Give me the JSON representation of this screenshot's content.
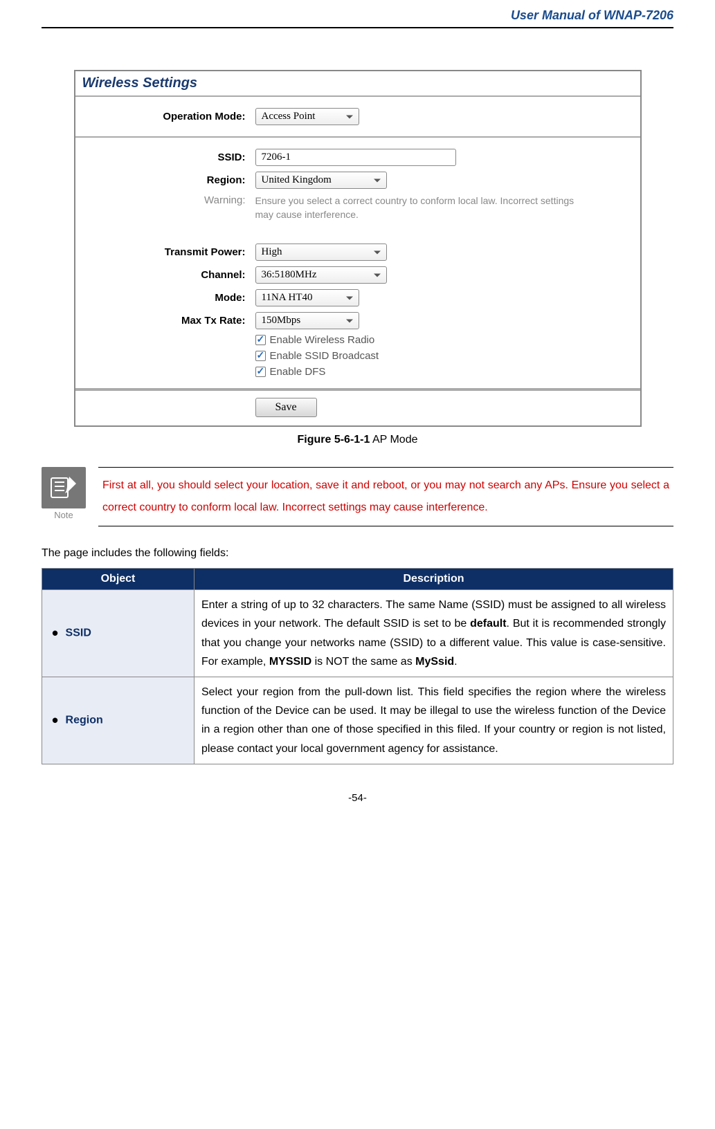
{
  "header": {
    "title": "User Manual of WNAP-7206"
  },
  "panel": {
    "title": "Wireless Settings",
    "operationMode": {
      "label": "Operation Mode:",
      "value": "Access Point"
    },
    "ssid": {
      "label": "SSID:",
      "value": "7206-1"
    },
    "region": {
      "label": "Region:",
      "value": "United Kingdom"
    },
    "warning": {
      "label": "Warning:",
      "text": "Ensure you select a correct country to conform local law. Incorrect settings may cause interference."
    },
    "transmitPower": {
      "label": "Transmit Power:",
      "value": "High"
    },
    "channel": {
      "label": "Channel:",
      "value": "36:5180MHz"
    },
    "mode": {
      "label": "Mode:",
      "value": "11NA HT40"
    },
    "maxTxRate": {
      "label": "Max Tx Rate:",
      "value": "150Mbps"
    },
    "checkboxes": {
      "enableRadio": "Enable Wireless Radio",
      "enableSSID": "Enable SSID Broadcast",
      "enableDFS": "Enable DFS"
    },
    "saveButton": "Save"
  },
  "figure": {
    "number": "Figure 5-6-1-1",
    "caption": " AP Mode"
  },
  "note": {
    "iconLabel": "Note",
    "text": "First at all, you should select your location, save it and reboot, or you may not search any APs. Ensure you select a correct country to conform local law. Incorrect settings may cause interference."
  },
  "intro": "The page includes the following fields:",
  "table": {
    "headers": {
      "object": "Object",
      "description": "Description"
    },
    "rows": [
      {
        "object": "SSID",
        "description": "Enter a string of up to 32 characters. The same Name (SSID) must be assigned to all wireless devices in your network. The default SSID is set to be <b>default</b>. But it is recommended strongly that you change your networks name (SSID) to a different value. This value is case-sensitive. For example, <b>MYSSID</b> is NOT the same as <b>MySsid</b>."
      },
      {
        "object": "Region",
        "description": "Select your region from the pull-down list. This field specifies the region where the wireless function of the Device can be used. It may be illegal to use the wireless function of the Device in a region other than one of those specified in this filed. If your country or region is not listed, please contact your local government agency for assistance."
      }
    ]
  },
  "pageNumber": "-54-"
}
